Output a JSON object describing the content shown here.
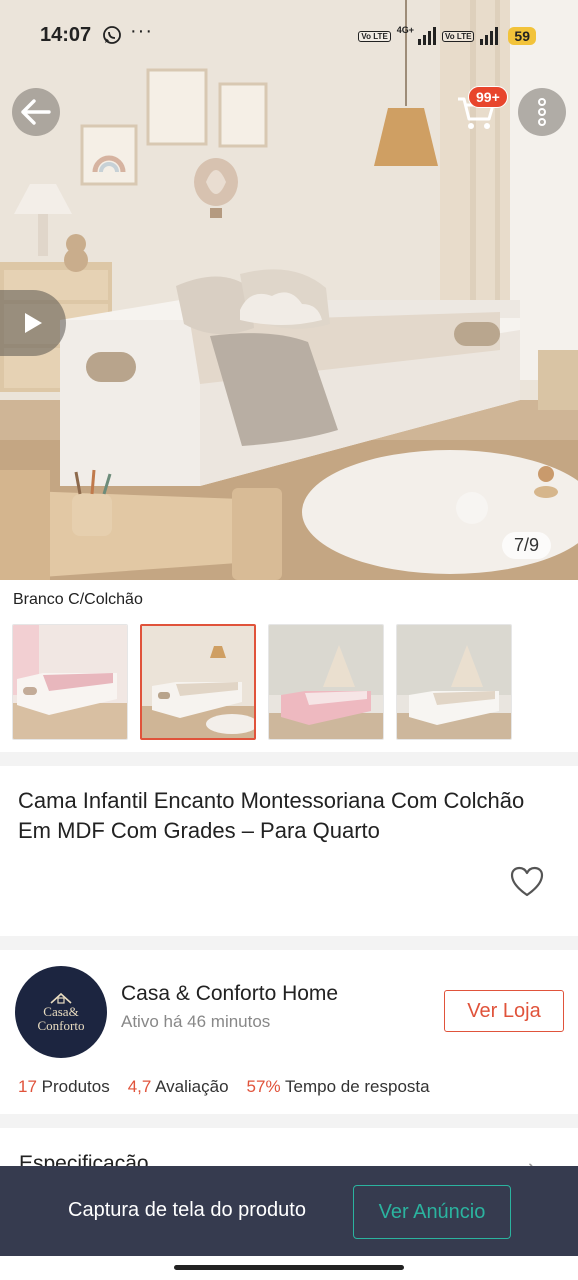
{
  "status_bar": {
    "time": "14:07",
    "app_icons": [
      "whatsapp-icon"
    ],
    "overflow": "···",
    "network": "4G+",
    "sim_labels": [
      "Vo LTE",
      "Vo LTE"
    ],
    "battery": "59",
    "battery_color": "#f2c33a"
  },
  "gallery": {
    "counter": "7/9"
  },
  "header": {
    "cart_badge": "99+",
    "badge_color": "#e8452c"
  },
  "variant": {
    "selected_label": "Branco C/Colchão",
    "thumbnails": [
      {
        "name": "thumb-pink",
        "selected": false
      },
      {
        "name": "thumb-white",
        "selected": true
      },
      {
        "name": "thumb-pink-tent",
        "selected": false
      },
      {
        "name": "thumb-white-tent",
        "selected": false
      }
    ]
  },
  "product": {
    "title": "Cama Infantil Encanto Montessoriana Com Colchão Em MDF Com Grades – Para Quarto"
  },
  "store": {
    "logo_line1": "Casa&",
    "logo_line2": "Conforto",
    "name": "Casa & Conforto Home",
    "status": "Ativo há 46 minutos",
    "visit_label": "Ver Loja",
    "stats": {
      "products_count": "17",
      "products_label": "Produtos",
      "rating_value": "4,7",
      "rating_label": "Avaliação",
      "response_value": "57%",
      "response_label": "Tempo de resposta"
    }
  },
  "specification": {
    "label": "Especificação"
  },
  "banner": {
    "text": "Captura de tela do produto",
    "button_label": "Ver Anúncio"
  },
  "colors": {
    "accent": "#e0533b",
    "banner_bg": "#363b4f",
    "banner_button": "#2bb39f"
  }
}
